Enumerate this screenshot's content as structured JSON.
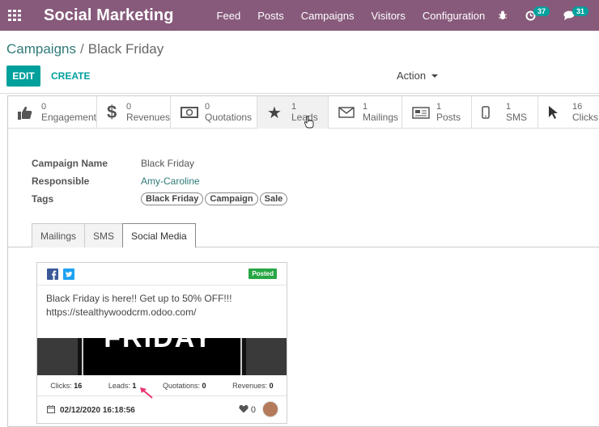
{
  "navbar": {
    "brand": "Social Marketing",
    "menu": [
      "Feed",
      "Posts",
      "Campaigns",
      "Visitors",
      "Configuration"
    ],
    "activity_badge": "37",
    "messages_badge": "31"
  },
  "breadcrumb": {
    "parent": "Campaigns",
    "separator": "/",
    "current": "Black Friday"
  },
  "buttons": {
    "edit": "EDIT",
    "create": "CREATE",
    "action": "Action"
  },
  "smart_buttons": [
    {
      "count": "0",
      "label": "Engagement",
      "icon": "thumbs-up-icon"
    },
    {
      "count": "0",
      "label": "Revenues",
      "icon": "dollar-icon"
    },
    {
      "count": "0",
      "label": "Quotations",
      "icon": "money-icon"
    },
    {
      "count": "1",
      "label": "Leads",
      "icon": "star-icon"
    },
    {
      "count": "1",
      "label": "Mailings",
      "icon": "envelope-icon"
    },
    {
      "count": "1",
      "label": "Posts",
      "icon": "newspaper-icon"
    },
    {
      "count": "1",
      "label": "SMS",
      "icon": "mobile-icon"
    },
    {
      "count": "16",
      "label": "Clicks",
      "icon": "pointer-icon"
    }
  ],
  "form": {
    "campaign_name_label": "Campaign Name",
    "campaign_name": "Black Friday",
    "responsible_label": "Responsible",
    "responsible": "Amy-Caroline",
    "tags_label": "Tags",
    "tags": [
      "Black Friday",
      "Campaign",
      "Sale"
    ]
  },
  "tabs": [
    "Mailings",
    "SMS",
    "Social Media"
  ],
  "post": {
    "status": "Posted",
    "message_line1": "Black Friday is here!! Get up to 50% OFF!!!",
    "message_line2": "https://stealthywoodcrm.odoo.com/",
    "image_text": "FRIDAY",
    "clicks_label": "Clicks:",
    "clicks": "16",
    "leads_label": "Leads:",
    "leads": "1",
    "quotations_label": "Quotations:",
    "quotations": "0",
    "revenues_label": "Revenues:",
    "revenues": "0",
    "date": "02/12/2020 16:18:56",
    "likes": "0"
  },
  "colors": {
    "navbar": "#875a7b",
    "primary": "#00a09d",
    "posted": "#28a745"
  }
}
